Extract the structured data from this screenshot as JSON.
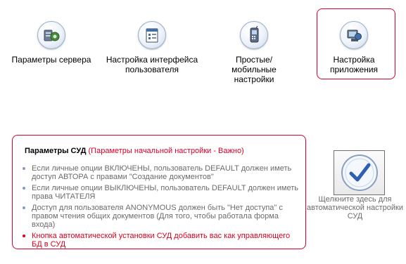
{
  "nav": [
    {
      "key": "server",
      "label": "Параметры сервера",
      "icon": "server-settings-icon"
    },
    {
      "key": "ui",
      "label": "Настройка интерфейса пользователя",
      "icon": "ui-settings-icon"
    },
    {
      "key": "mobile",
      "label": "Простые/мобильные настройки",
      "icon": "mobile-phone-icon"
    },
    {
      "key": "app",
      "label": "Настройка приложения",
      "icon": "app-settings-icon"
    }
  ],
  "panel": {
    "title": "Параметры СУД",
    "subtitle": "(Параметры начальной настройки - Важно)",
    "items": [
      "Если личные опции ВКЛЮЧЕНЫ, пользователь DEFAULT должен иметь доступ АВТОРА с правами \"Создание документов\"",
      "Если личные опции ВЫКЛЮЧЕНЫ, пользователь DEFAULT должен иметь права ЧИТАТЕЛЯ",
      "Доступ для пользователя ANONYMOUS должен быть \"Нет доступа\" с правом чтения общих документов (Для того, чтобы работала форма входа)",
      "Кнопка автоматической установки СУД добавить вас как управляющего БД в СУД"
    ]
  },
  "auto_setup": {
    "icon": "checkmark-icon",
    "caption": "Щелкните здесь для автоматической настройки СУД"
  },
  "colors": {
    "accent_red": "#d9002a",
    "muted_text": "#6b6b6b",
    "check_blue": "#2f5fb0"
  }
}
